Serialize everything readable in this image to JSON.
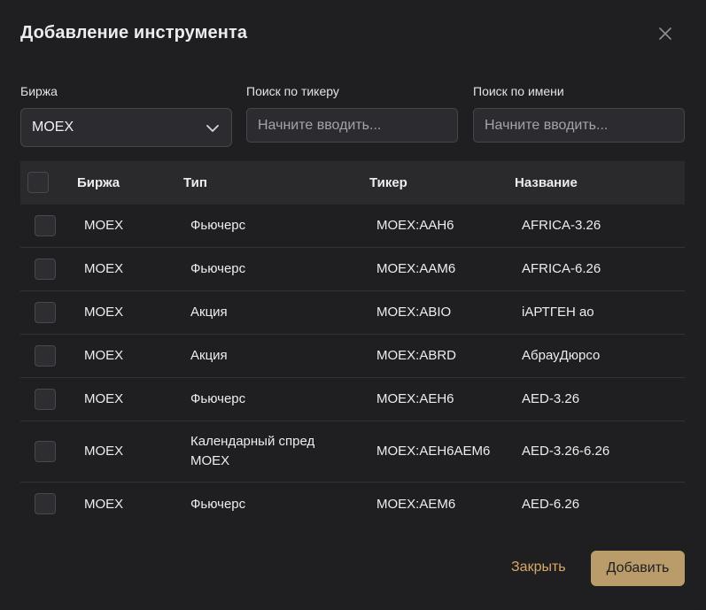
{
  "dialog": {
    "title": "Добавление инструмента",
    "close_icon": "close-icon"
  },
  "filters": {
    "exchange_label": "Биржа",
    "exchange_value": "MOEX",
    "ticker_label": "Поиск по тикеру",
    "ticker_placeholder": "Начните вводить...",
    "name_label": "Поиск по имени",
    "name_placeholder": "Начните вводить..."
  },
  "table": {
    "columns": [
      "Биржа",
      "Тип",
      "Тикер",
      "Название"
    ],
    "rows": [
      {
        "exchange": "MOEX",
        "type": "Фьючерс",
        "ticker": "MOEX:AAH6",
        "name": "AFRICA-3.26"
      },
      {
        "exchange": "MOEX",
        "type": "Фьючерс",
        "ticker": "MOEX:AAM6",
        "name": "AFRICA-6.26"
      },
      {
        "exchange": "MOEX",
        "type": "Акция",
        "ticker": "MOEX:ABIO",
        "name": "iАРТГЕН ао"
      },
      {
        "exchange": "MOEX",
        "type": "Акция",
        "ticker": "MOEX:ABRD",
        "name": "АбрауДюрсо"
      },
      {
        "exchange": "MOEX",
        "type": "Фьючерс",
        "ticker": "MOEX:AEH6",
        "name": "AED-3.26"
      },
      {
        "exchange": "MOEX",
        "type": "Календарный спред MOEX",
        "ticker": "MOEX:AEH6AEM6",
        "name": "AED-3.26-6.26"
      },
      {
        "exchange": "MOEX",
        "type": "Фьючерс",
        "ticker": "MOEX:AEM6",
        "name": "AED-6.26"
      }
    ]
  },
  "footer": {
    "close_label": "Закрыть",
    "add_label": "Добавить"
  },
  "colors": {
    "background": "#1f1f22",
    "accent_text": "#d9a864",
    "accent_button": "#b99c6a"
  }
}
